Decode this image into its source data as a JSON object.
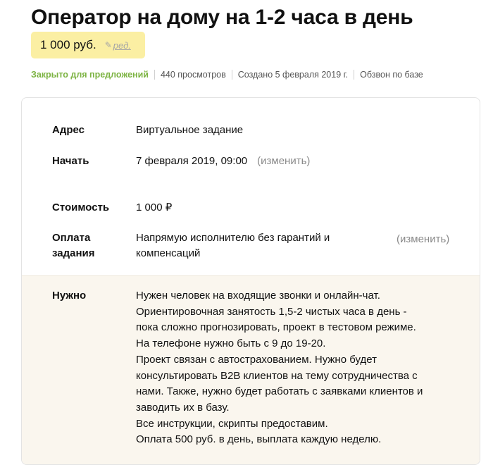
{
  "title": "Оператор на дому на 1-2 часа в день",
  "price": {
    "amount": "1 000 руб.",
    "edit_label": "ред.",
    "edit_icon": "pencil-icon",
    "bg_color": "#fbefa3"
  },
  "meta": {
    "status": "Закрыто для предложений",
    "status_color": "#7cb342",
    "views": "440 просмотров",
    "created": "Создано 5 февраля 2019 г.",
    "type": "Обзвон по базе"
  },
  "details": {
    "address_label": "Адрес",
    "address_value": "Виртуальное задание",
    "start_label": "Начать",
    "start_value": "7 февраля 2019, 09:00",
    "start_change": "(изменить)",
    "cost_label": "Стоимость",
    "cost_value": "1 000 ₽",
    "payment_label_line1": "Оплата",
    "payment_label_line2": "задания",
    "payment_value_line1": "Напрямую исполнителю без гарантий и",
    "payment_value_line2": "компенсаций",
    "payment_change": "(изменить)",
    "need_label": "Нужно",
    "need_lines": [
      "Нужен человек на входящие звонки и онлайн-чат.",
      "Ориентировочная занятость 1,5-2 чистых часа в день -",
      "пока сложно прогнозировать, проект в тестовом режиме.",
      "На телефоне нужно быть с 9 до 19-20.",
      "Проект связан с автострахованием. Нужно будет",
      "консультировать B2B клиентов на тему сотрудничества с",
      "нами. Также, нужно будет работать с заявками клиентов и",
      "заводить их в базу.",
      "Все инструкции, скрипты предоставим.",
      "Оплата 500 руб. в день, выплата каждую неделю."
    ]
  }
}
